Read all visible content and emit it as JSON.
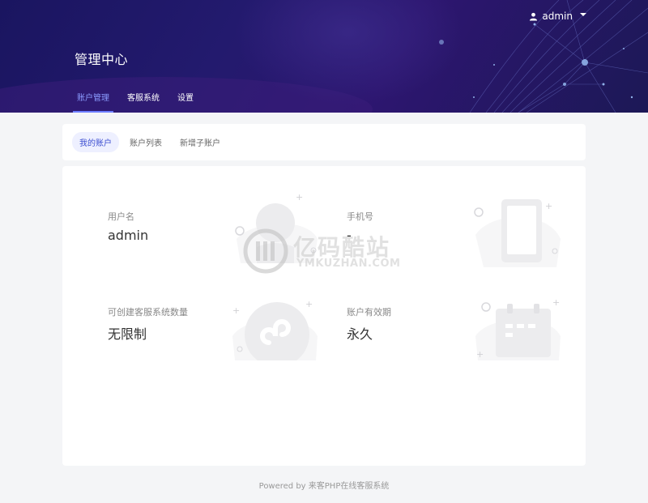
{
  "header": {
    "username": "admin",
    "title": "管理中心",
    "nav": [
      {
        "label": "账户管理",
        "active": true
      },
      {
        "label": "客服系统",
        "active": false
      },
      {
        "label": "设置",
        "active": false
      }
    ]
  },
  "subtabs": [
    {
      "label": "我的账户",
      "active": true
    },
    {
      "label": "账户列表",
      "active": false
    },
    {
      "label": "新增子账户",
      "active": false
    }
  ],
  "account_info": {
    "username_label": "用户名",
    "username_value": "admin",
    "phone_label": "手机号",
    "phone_value": "-",
    "quota_label": "可创建客服系统数量",
    "quota_value": "无限制",
    "validity_label": "账户有效期",
    "validity_value": "永久"
  },
  "watermark": {
    "cn": "亿码酷站",
    "en": "YMKUZHAN.COM"
  },
  "footer": {
    "text": "Powered by 来客PHP在线客服系统"
  },
  "colors": {
    "header_bg": "#1f1766",
    "accent": "#6d7dff",
    "background": "#f4f5f7"
  }
}
